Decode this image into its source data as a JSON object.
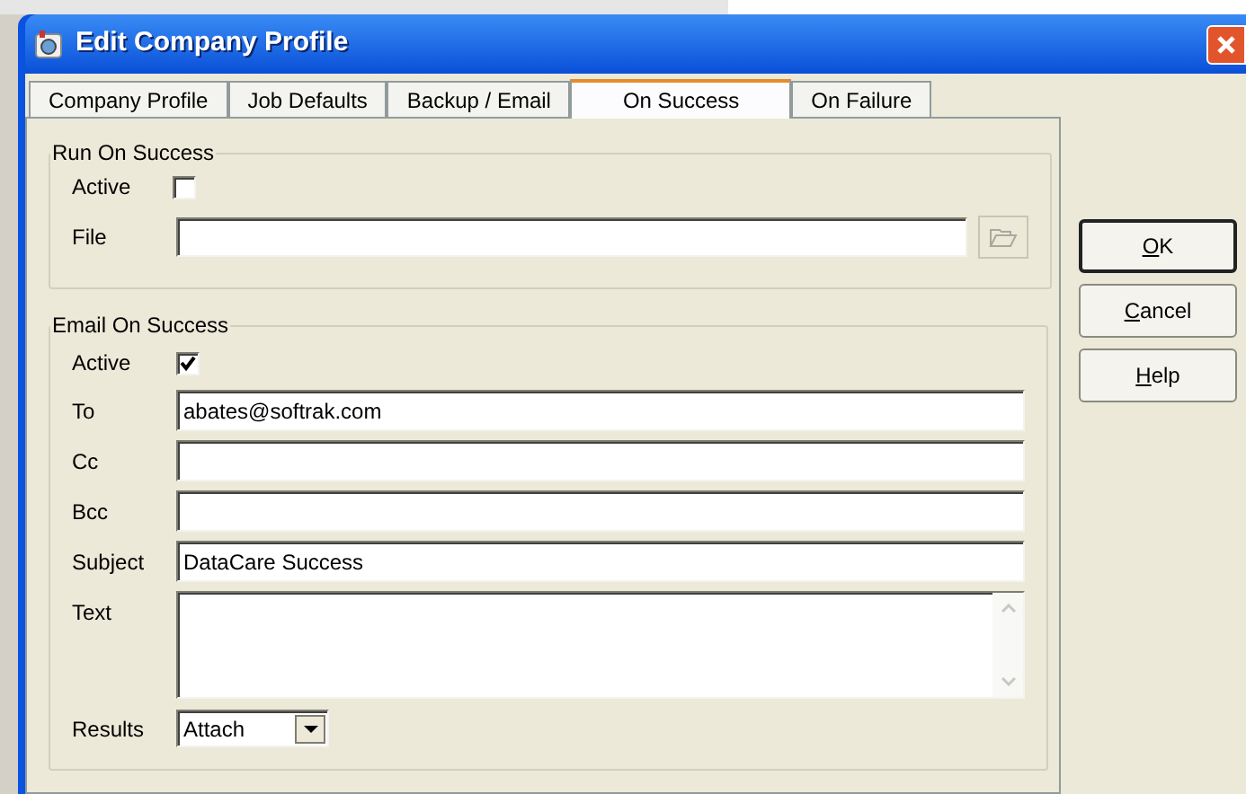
{
  "window": {
    "title": "Edit Company Profile"
  },
  "tabs": [
    {
      "label": "Company Profile",
      "selected": false
    },
    {
      "label": "Job Defaults",
      "selected": false
    },
    {
      "label": "Backup / Email",
      "selected": false
    },
    {
      "label": "On Success",
      "selected": true
    },
    {
      "label": "On Failure",
      "selected": false
    }
  ],
  "run_on_success": {
    "title": "Run On Success",
    "active": {
      "label": "Active",
      "checked": false
    },
    "file": {
      "label": "File"
    }
  },
  "email_on_success": {
    "title": "Email On Success",
    "active": {
      "label": "Active",
      "checked": true
    },
    "fields": [
      {
        "kind": "line",
        "label": "To",
        "value": "abates@softrak.com"
      },
      {
        "kind": "line",
        "label": "Cc"
      },
      {
        "kind": "line",
        "label": "Bcc"
      },
      {
        "kind": "line",
        "label": "Subject",
        "value": "DataCare Success"
      },
      {
        "kind": "memo",
        "label": "Text"
      }
    ],
    "results": {
      "label": "Results",
      "value": "Attach"
    }
  },
  "buttons": [
    {
      "label": "OK",
      "default": true
    },
    {
      "label": "Cancel",
      "default": false
    },
    {
      "label": "Help",
      "default": false
    }
  ]
}
